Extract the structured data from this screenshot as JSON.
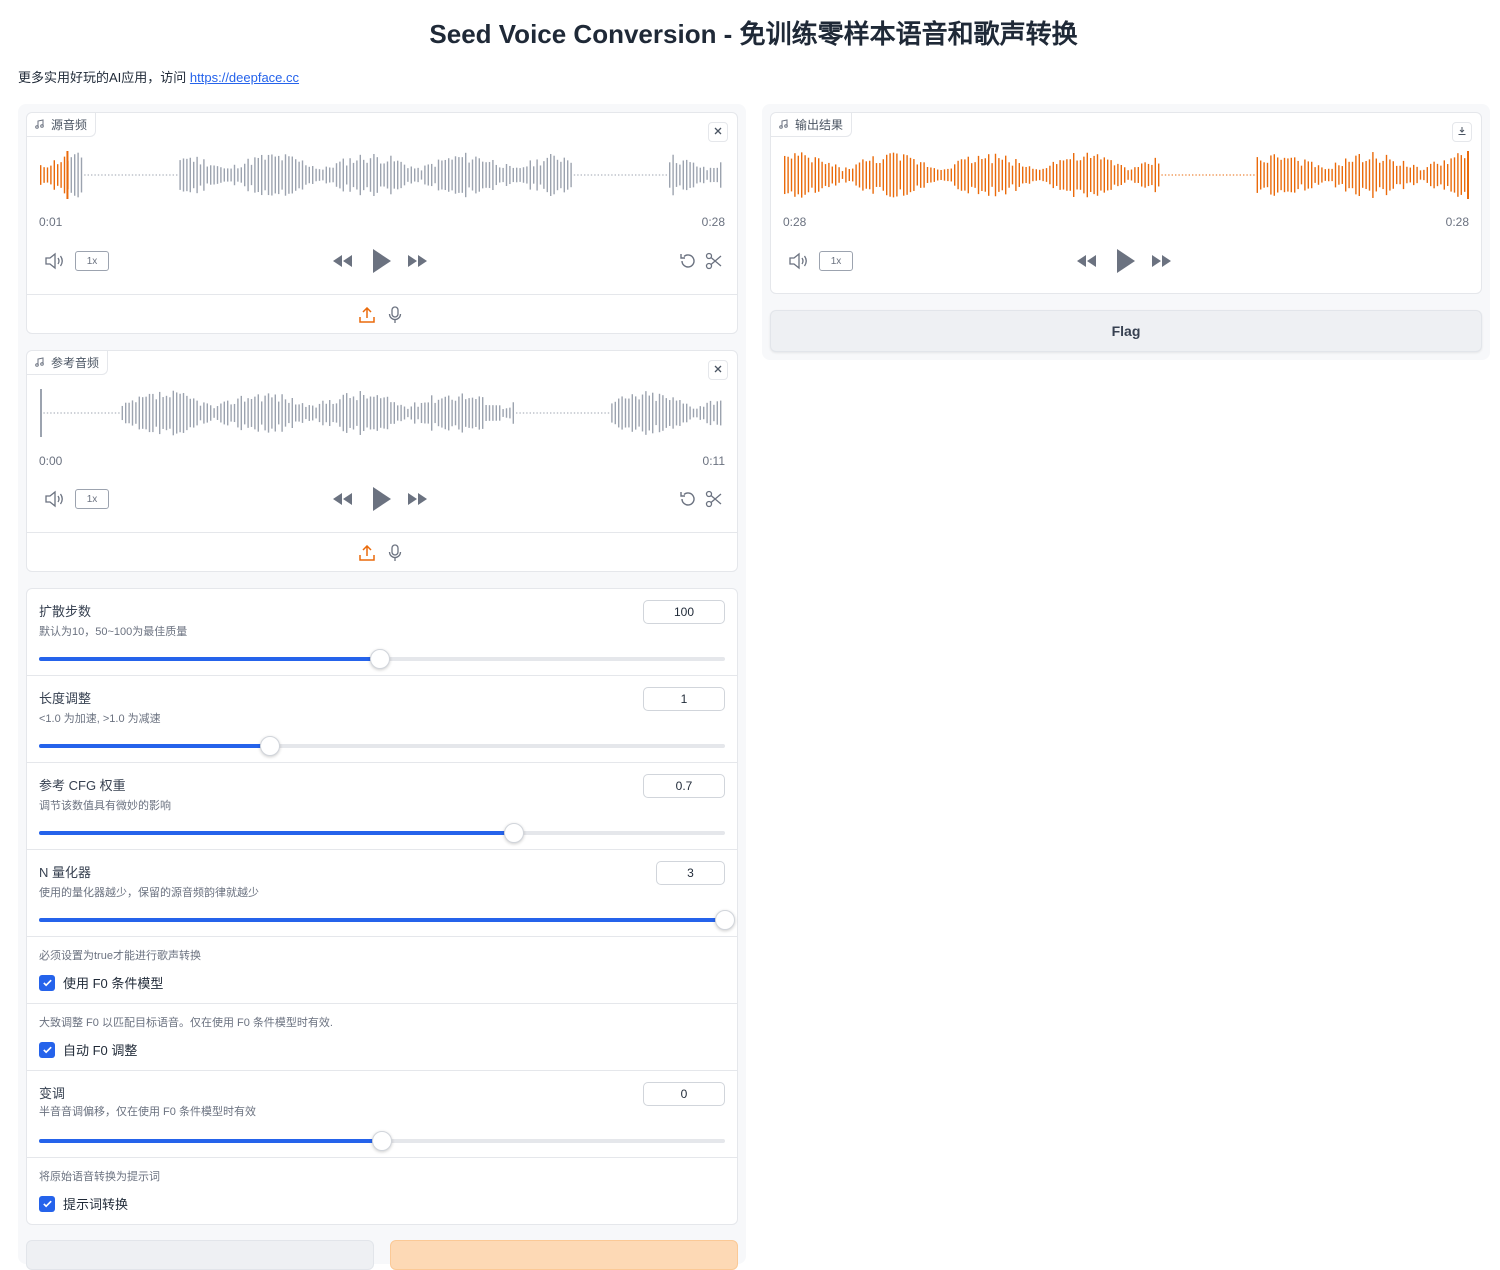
{
  "header": {
    "title": "Seed Voice Conversion - 免训练零样本语音和歌声转换",
    "subtitle_prefix": "更多实用好玩的AI应用，访问 ",
    "subtitle_link": "https://deepface.cc"
  },
  "source_audio": {
    "label": "源音频",
    "current_time": "0:01",
    "duration": "0:28",
    "rate": "1x",
    "progress": 0.04
  },
  "reference_audio": {
    "label": "参考音频",
    "current_time": "0:00",
    "duration": "0:11",
    "rate": "1x",
    "progress": 0.0
  },
  "output_audio": {
    "label": "输出结果",
    "current_time": "0:28",
    "duration": "0:28",
    "rate": "1x",
    "progress": 1.0
  },
  "flag_label": "Flag",
  "settings": {
    "diffusion_steps": {
      "label": "扩散步数",
      "info": "默认为10，50~100为最佳质量",
      "value": "100",
      "fraction": 0.497
    },
    "length_adjust": {
      "label": "长度调整",
      "info": "<1.0 为加速, >1.0 为减速",
      "value": "1",
      "fraction": 0.337
    },
    "cfg_weight": {
      "label": "参考 CFG 权重",
      "info": "调节该数值具有微妙的影响",
      "value": "0.7",
      "fraction": 0.693
    },
    "n_quantizers": {
      "label": "N 量化器",
      "info": "使用的量化器越少，保留的源音频韵律就越少",
      "value": "3",
      "fraction": 1.0
    },
    "f0_condition": {
      "info": "必须设置为true才能进行歌声转换",
      "label": "使用 F0 条件模型",
      "checked": true
    },
    "auto_f0": {
      "info": "大致调整 F0 以匹配目标语音。仅在使用 F0 条件模型时有效.",
      "label": "自动 F0 调整",
      "checked": true
    },
    "pitch_shift": {
      "label": "变调",
      "info": "半音音调偏移，仅在使用 F0 条件模型时有效",
      "value": "0",
      "fraction": 0.5
    },
    "prompt_convert": {
      "info": "将原始语音转换为提示词",
      "label": "提示词转换",
      "checked": true
    }
  },
  "colors": {
    "accent_blue": "#2563eb",
    "waveform_played": "#ea6a0b",
    "waveform_unplayed": "#9ca3af",
    "submit_orange": "#fdd9b5"
  },
  "icons": {
    "music": "music-note-icon",
    "close": "close-icon",
    "download": "download-icon",
    "volume": "volume-icon",
    "rewind": "rewind-icon",
    "play": "play-icon",
    "forward": "fast-forward-icon",
    "reset": "reset-icon",
    "trim": "scissors-icon",
    "upload": "upload-icon",
    "mic": "microphone-icon"
  }
}
